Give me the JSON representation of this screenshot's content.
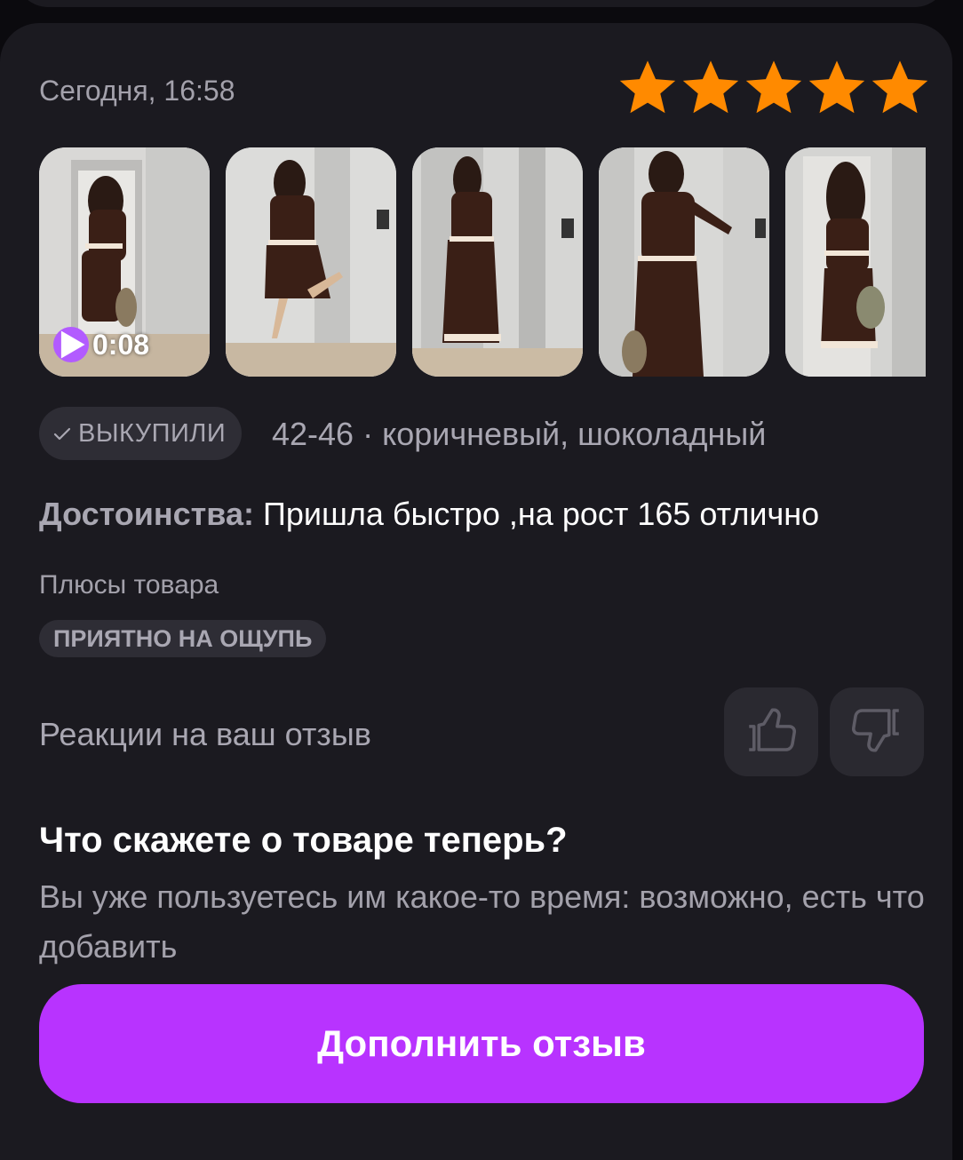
{
  "review": {
    "date": "Сегодня, 16:58",
    "rating": 5,
    "rating_color": "#ff8a00",
    "photos": [
      {
        "name": "review-photo-1-video",
        "video_duration": "0:08"
      },
      {
        "name": "review-photo-2"
      },
      {
        "name": "review-photo-3"
      },
      {
        "name": "review-photo-4"
      },
      {
        "name": "review-photo-5"
      }
    ],
    "purchased_badge": "ВЫКУПИЛИ",
    "size_color": "42-46 · коричневый, шоколадный",
    "merits_label": "Достоинства:",
    "merits_text": "Пришла быстро ,на рост 165 отлично",
    "pros_title": "Плюсы товара",
    "pros_tags": [
      "ПРИЯТНО НА ОЩУПЬ"
    ],
    "reactions_label": "Реакции на ваш отзыв",
    "reaction_icons": [
      "thumbs-up-icon",
      "thumbs-down-icon"
    ]
  },
  "prompt": {
    "title": "Что скажете о товаре теперь?",
    "text": "Вы уже пользуетесь им какое-то время: возможно, есть что добавить"
  },
  "cta": {
    "label": "Дополнить отзыв",
    "color": "#b833ff"
  }
}
